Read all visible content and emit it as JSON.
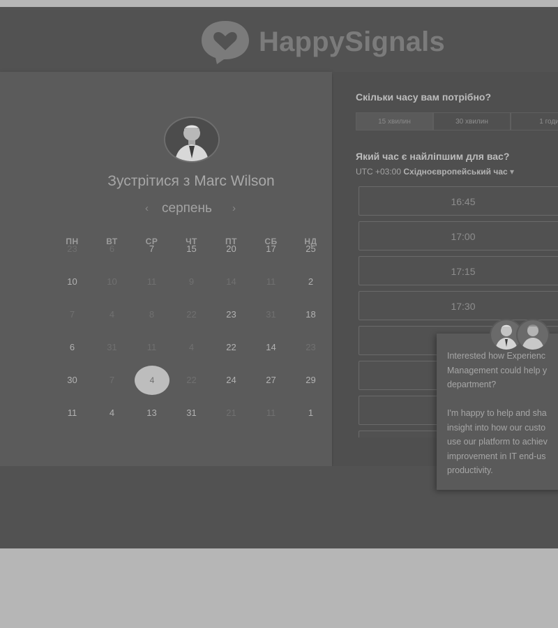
{
  "brand": {
    "name": "HappySignals"
  },
  "left_panel": {
    "meet_prefix": "Зустрітися з",
    "host_name": "Marc Wilson",
    "month": "серпень",
    "weekdays": [
      "ПН",
      "ВТ",
      "СР",
      "ЧТ",
      "ПТ",
      "СБ",
      "НД"
    ],
    "weeks": [
      [
        {
          "d": "23",
          "dim": true
        },
        {
          "d": "6",
          "dim": true
        },
        {
          "d": "7"
        },
        {
          "d": "15"
        },
        {
          "d": "20"
        },
        {
          "d": "17"
        },
        {
          "d": "25"
        }
      ],
      [
        {
          "d": "10"
        },
        {
          "d": "10",
          "dim": true
        },
        {
          "d": "11",
          "dim": true
        },
        {
          "d": "9",
          "dim": true
        },
        {
          "d": "14",
          "dim": true
        },
        {
          "d": "11",
          "dim": true
        },
        {
          "d": "2"
        }
      ],
      [
        {
          "d": "7",
          "dim": true
        },
        {
          "d": "4",
          "dim": true
        },
        {
          "d": "8",
          "dim": true
        },
        {
          "d": "22",
          "dim": true
        },
        {
          "d": "23"
        },
        {
          "d": "31",
          "dim": true
        },
        {
          "d": "18"
        }
      ],
      [
        {
          "d": "6"
        },
        {
          "d": "31",
          "dim": true
        },
        {
          "d": "11",
          "dim": true
        },
        {
          "d": "4",
          "dim": true
        },
        {
          "d": "22"
        },
        {
          "d": "14"
        },
        {
          "d": "23",
          "dim": true
        }
      ],
      [
        {
          "d": "30"
        },
        {
          "d": "7",
          "dim": true
        },
        {
          "d": "4",
          "selected": true
        },
        {
          "d": "22",
          "dim": true
        },
        {
          "d": "24"
        },
        {
          "d": "27"
        },
        {
          "d": "29"
        }
      ],
      [
        {
          "d": "11"
        },
        {
          "d": "4"
        },
        {
          "d": "13"
        },
        {
          "d": "31"
        },
        {
          "d": "21",
          "dim": true
        },
        {
          "d": "11",
          "dim": true
        },
        {
          "d": "1"
        }
      ]
    ]
  },
  "right_panel": {
    "duration_question": "Скільки часу вам потрібно?",
    "durations": [
      "15 хвилин",
      "30 хвилин",
      "1 годи"
    ],
    "active_duration_index": 0,
    "time_question": "Який час є найліпшим для вас?",
    "tz_offset": "UTC +03:00",
    "tz_name": "Східноєвропейський час",
    "tz_caret": "▾",
    "slots": [
      "16:45",
      "17:00",
      "17:15",
      "17:30",
      "",
      "",
      "",
      ""
    ]
  },
  "chat": {
    "message": "Interested how Experienc\nManagement could help y\ndepartment?\n\nI'm happy to help and sha\ninsight into how our custo\nuse our platform to achiev\nimprovement in IT end-us\nproductivity."
  },
  "colors": {
    "background": "#525252",
    "left_panel": "#5b5b5b",
    "right_panel": "#4f4f4f",
    "selected_day": "#bdbdbd",
    "outer": "#b6b6b6"
  }
}
